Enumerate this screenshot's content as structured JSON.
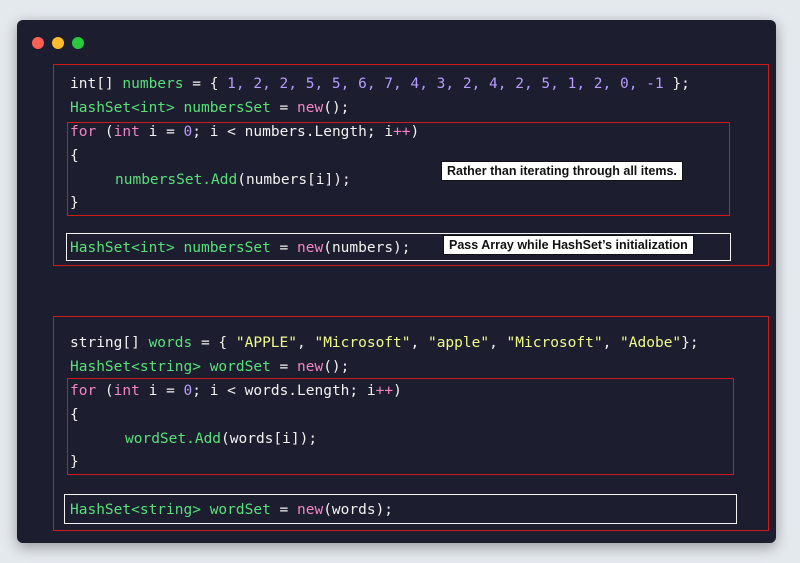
{
  "window": {
    "controls": [
      "close",
      "minimize",
      "zoom"
    ],
    "colors": {
      "background": "#1c1d2e",
      "close": "#ff5f57",
      "minimize": "#febc2e",
      "zoom": "#28c840",
      "highlight": "#d11a1a",
      "annotation": "#f2f2f2"
    }
  },
  "section1": {
    "line1": {
      "type": "int[]",
      "var": "numbers",
      "assign": " = { ",
      "values": "1, 2, 2, 5, 5, 6, 7, 4, 3, 2, 4, 2, 5, 1, 2, 0, -1",
      "end": " };"
    },
    "line2": {
      "generic": "HashSet<int>",
      "var": "numbersSet",
      "assign": " = ",
      "new": "new",
      "end": "();"
    },
    "loop": {
      "for": "for",
      "header_open": " (",
      "int": "int",
      "header_rest": " i = ",
      "zero": "0",
      "cond": "; i < numbers.Length; i",
      "incr": "++",
      "close": ")",
      "brace_open": "{",
      "body_fn": "numbersSet.Add",
      "body_args": "(numbers[i]);",
      "brace_close": "}"
    },
    "note_loop": "Rather than iterating through all items.",
    "alt": {
      "generic": "HashSet<int>",
      "var": "numbersSet",
      "assign": " = ",
      "new": "new",
      "args": "(numbers);"
    },
    "note_alt": "Pass Array while HashSet’s initialization"
  },
  "section2": {
    "line1": {
      "type": "string[]",
      "var": "words",
      "assign": " = { ",
      "s1": "\"APPLE\"",
      "s2": "\"Microsoft\"",
      "s3": "\"apple\"",
      "s4": "\"Microsoft\"",
      "s5": "\"Adobe\"",
      "sep": ", ",
      "end": "};"
    },
    "line2": {
      "generic": "HashSet<string>",
      "var": "wordSet",
      "assign": " = ",
      "new": "new",
      "end": "();"
    },
    "loop": {
      "for": "for",
      "header_open": " (",
      "int": "int",
      "header_rest": " i = ",
      "zero": "0",
      "cond": "; i < words.Length; i",
      "incr": "++",
      "close": ")",
      "brace_open": "{",
      "body_fn": "wordSet.Add",
      "body_args": "(words[i]);",
      "brace_close": "}"
    },
    "alt": {
      "generic": "HashSet<string>",
      "var": "wordSet",
      "assign": " = ",
      "new": "new",
      "args": "(words);"
    }
  }
}
